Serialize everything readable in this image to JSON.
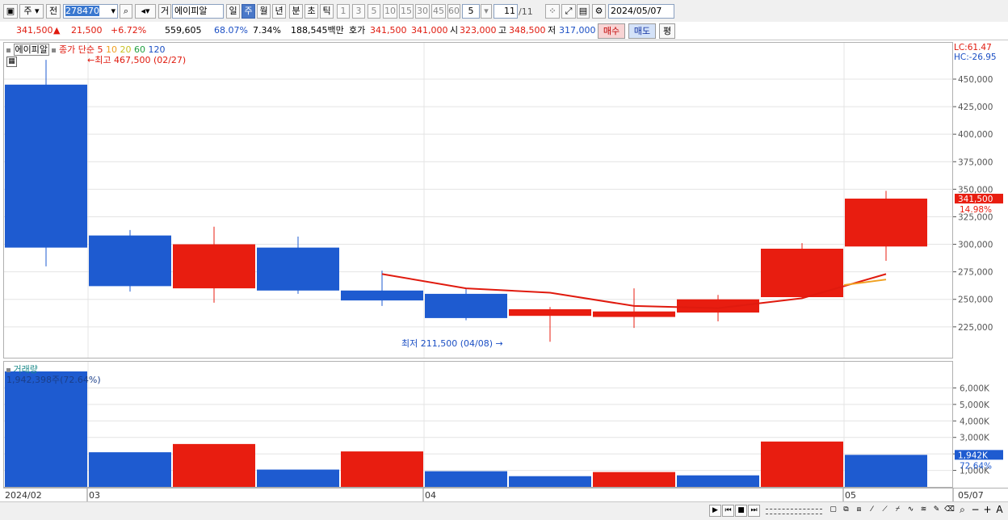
{
  "toolbar": {
    "market": "주",
    "prev_label": "전",
    "code": "278470",
    "mode_label": "거",
    "stock_name": "에이피알",
    "periods": [
      "일",
      "주",
      "월",
      "년",
      "분",
      "초",
      "틱"
    ],
    "selected_period": "주",
    "intervals": [
      "1",
      "3",
      "5",
      "10",
      "15",
      "30",
      "45",
      "60"
    ],
    "count": "5",
    "page": "11",
    "page_total": "/11",
    "date": "2024/05/07"
  },
  "info": {
    "price": "341,500",
    "change_arrow": "▲",
    "change": "21,500",
    "change_pct": "+6.72%",
    "volume": "559,605",
    "volume_pct": "68.07%",
    "turnover": "7.34%",
    "amount": "188,545백만",
    "bid_ask_label": "호가",
    "ask": "341,500",
    "bid": "341,000",
    "open_label": "시",
    "open": "323,000",
    "high_label": "고",
    "high": "348,500",
    "low_label": "저",
    "low": "317,000",
    "buy_button": "매수",
    "sell_button": "매도",
    "eval_button": "평"
  },
  "legend": {
    "name": "에이피알",
    "close_label": "종가",
    "ma_type": "단순",
    "ma_periods": [
      "5",
      "10",
      "20",
      "60",
      "120"
    ],
    "ma_colors": [
      "#e01a0e",
      "#f0a020",
      "#c8c020",
      "#20a040",
      "#1b4fc4"
    ],
    "high_marker": "최고 467,500 (02/27)",
    "low_marker": "최저 211,500 (04/08)",
    "lc": "LC:61.47",
    "hc": "HC:-26.95"
  },
  "volume_legend": {
    "title": "거래량",
    "value": "1,942,398주(72.64%)"
  },
  "colors": {
    "up": "#e81d10",
    "down": "#1e5bd0",
    "ma5": "#e01a0e",
    "ma10": "#f0a020"
  },
  "chart_data": {
    "type": "candlestick",
    "period": "weekly",
    "candles": [
      {
        "week": "2024/02 wk4",
        "open": 445000,
        "high": 467500,
        "low": 280000,
        "close": 297000
      },
      {
        "week": "2024/03 wk1",
        "open": 308000,
        "high": 313000,
        "low": 257000,
        "close": 262000
      },
      {
        "week": "2024/03 wk2",
        "open": 260000,
        "high": 316000,
        "low": 247000,
        "close": 300000
      },
      {
        "week": "2024/03 wk3",
        "open": 297000,
        "high": 307000,
        "low": 255000,
        "close": 258000
      },
      {
        "week": "2024/03 wk4",
        "open": 258000,
        "high": 276000,
        "low": 244000,
        "close": 249000
      },
      {
        "week": "2024/04 wk1",
        "open": 255000,
        "high": 260000,
        "low": 231000,
        "close": 233000
      },
      {
        "week": "2024/04 wk2",
        "open": 235000,
        "high": 243000,
        "low": 211500,
        "close": 241000
      },
      {
        "week": "2024/04 wk3",
        "open": 234000,
        "high": 260000,
        "low": 224000,
        "close": 239000
      },
      {
        "week": "2024/04 wk4",
        "open": 238000,
        "high": 254000,
        "low": 230000,
        "close": 250000
      },
      {
        "week": "2024/04 wk5",
        "open": 252000,
        "high": 301000,
        "low": 251000,
        "close": 296000
      },
      {
        "week": "2024/05 wk1",
        "open": 298000,
        "high": 348500,
        "low": 285000,
        "close": 341500
      }
    ],
    "ma5": [
      null,
      null,
      null,
      null,
      273000,
      260000,
      256000,
      244000,
      242000,
      251000,
      273000
    ],
    "ma10": [
      null,
      null,
      null,
      null,
      null,
      null,
      null,
      null,
      null,
      null,
      268000
    ],
    "volume_k": [
      7000,
      2100,
      2600,
      1050,
      2150,
      950,
      650,
      900,
      700,
      2750,
      1942
    ],
    "volume_up": [
      false,
      false,
      true,
      false,
      true,
      false,
      false,
      true,
      false,
      true,
      false
    ],
    "y_axis_ticks": [
      "450,000",
      "425,000",
      "400,000",
      "375,000",
      "350,000",
      "325,000",
      "300,000",
      "275,000",
      "250,000",
      "225,000"
    ],
    "y_tick_values": [
      450000,
      425000,
      400000,
      375000,
      350000,
      325000,
      300000,
      275000,
      250000,
      225000
    ],
    "y_range": [
      197000,
      483000
    ],
    "last_price_label": "341,500",
    "last_price_pct": "14.98%",
    "vol_axis_ticks": [
      "6,000K",
      "5,000K",
      "4,000K",
      "3,000K",
      "2,000K",
      "1,000K"
    ],
    "vol_tick_values": [
      6000,
      5000,
      4000,
      3000,
      2000,
      1000
    ],
    "vol_range": [
      0,
      7000
    ],
    "last_vol_label": "1,942K",
    "last_vol_pct": "72.64%",
    "x_labels": [
      {
        "index": 0,
        "text": "2024/02"
      },
      {
        "index": 1,
        "text": "03"
      },
      {
        "index": 5,
        "text": "04"
      },
      {
        "index": 10,
        "text": "05"
      }
    ],
    "x_axis_right_label": "05/07"
  }
}
